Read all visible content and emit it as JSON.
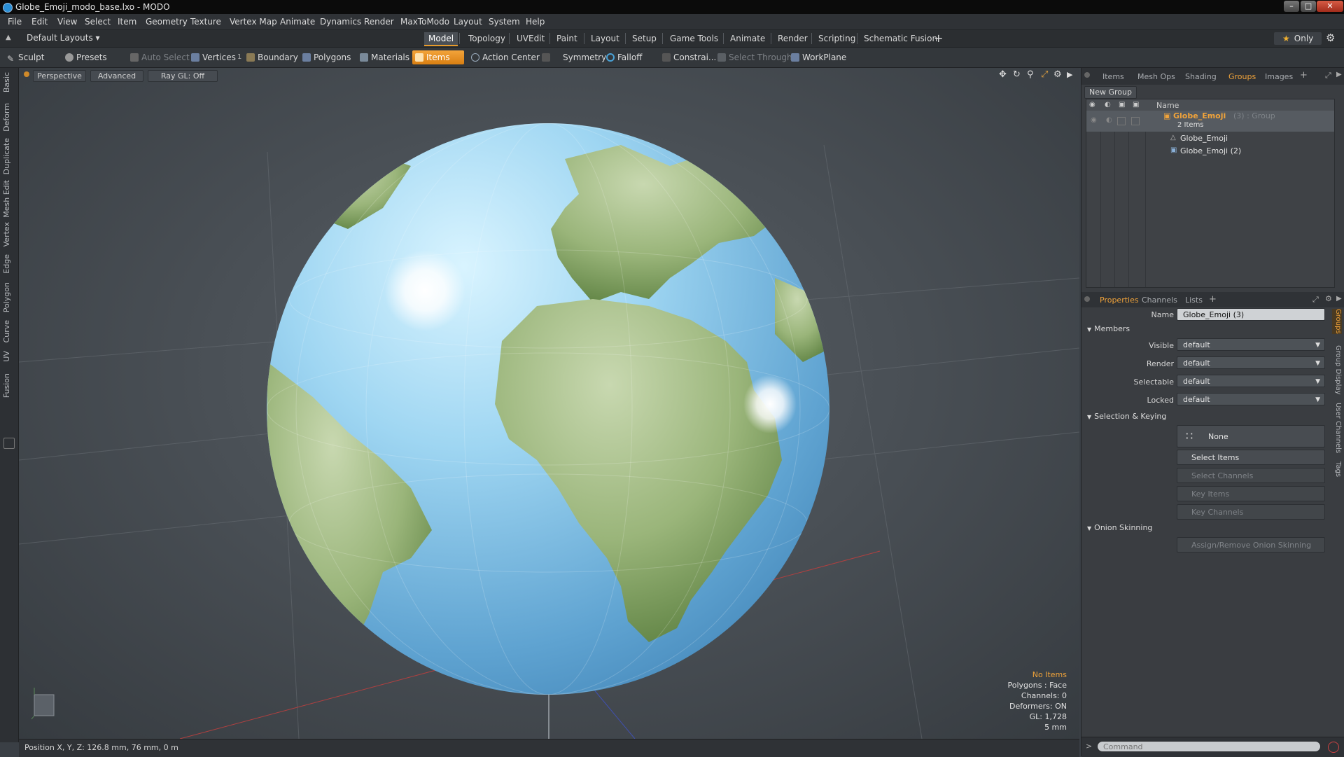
{
  "window": {
    "title": "Globe_Emoji_modo_base.lxo - MODO"
  },
  "menu": [
    "File",
    "Edit",
    "View",
    "Select",
    "Item",
    "Geometry",
    "Texture",
    "Vertex Map",
    "Animate",
    "Dynamics",
    "Render",
    "MaxToModo",
    "Layout",
    "System",
    "Help"
  ],
  "layoutbar": {
    "layouts_label": "Default Layouts",
    "tabs": [
      "Model",
      "Topology",
      "UVEdit",
      "Paint",
      "Layout",
      "Setup",
      "Game Tools",
      "Animate",
      "Render",
      "Scripting",
      "Schematic Fusion"
    ],
    "active_tab": "Model",
    "only_label": "Only"
  },
  "toolbar": {
    "sculpt": "Sculpt",
    "presets": "Presets",
    "auto_select": "Auto Select",
    "vertices": "Vertices",
    "vertices_count": "1",
    "boundary": "Boundary",
    "polygons": "Polygons",
    "materials": "Materials",
    "items": "Items",
    "action_center": "Action Center",
    "symmetry": "Symmetry",
    "falloff": "Falloff",
    "constraints": "Constrai...",
    "select_through": "Select Through",
    "workplane": "WorkPlane"
  },
  "left_tabs": [
    "Basic",
    "Deform",
    "Duplicate",
    "Mesh Edit",
    "Vertex",
    "Edge",
    "Polygon",
    "Curve",
    "UV",
    "Fusion"
  ],
  "viewport": {
    "perspective": "Perspective",
    "advanced": "Advanced",
    "raygl": "Ray GL: Off",
    "stats": {
      "items": "No Items",
      "polygons": "Polygons : Face",
      "channels": "Channels: 0",
      "deformers": "Deformers: ON",
      "gl": "GL: 1,728",
      "unit": "5 mm"
    },
    "colors": {
      "ocean": "#6fb0dc",
      "land": "#7d9e5c"
    }
  },
  "statusbar": {
    "position": "Position X, Y, Z:  126.8 mm, 76 mm, 0 m"
  },
  "groups_panel": {
    "tabs": [
      "Items",
      "Mesh Ops",
      "Shading",
      "Groups",
      "Images"
    ],
    "active_tab": "Groups",
    "new_group": "New Group",
    "name_header": "Name",
    "group_name": "Globe_Emoji",
    "group_suffix": "(3) : Group",
    "group_count": "2 Items",
    "children": [
      "Globe_Emoji",
      "Globe_Emoji (2)"
    ]
  },
  "properties_panel": {
    "tabs": [
      "Properties",
      "Channels",
      "Lists"
    ],
    "active_tab": "Properties",
    "name_label": "Name",
    "name_value": "Globe_Emoji (3)",
    "members_section": "Members",
    "visible_label": "Visible",
    "visible_value": "default",
    "render_label": "Render",
    "render_value": "default",
    "selectable_label": "Selectable",
    "selectable_value": "default",
    "locked_label": "Locked",
    "locked_value": "default",
    "selkey_section": "Selection & Keying",
    "none_label": "None",
    "select_items": "Select Items",
    "select_channels": "Select Channels",
    "key_items": "Key Items",
    "key_channels": "Key Channels",
    "onion_section": "Onion Skinning",
    "onion_button": "Assign/Remove Onion Skinning",
    "side_tabs": [
      "Groups",
      "Group Display",
      "User Channels",
      "Tags"
    ]
  },
  "command": {
    "placeholder": "Command"
  }
}
